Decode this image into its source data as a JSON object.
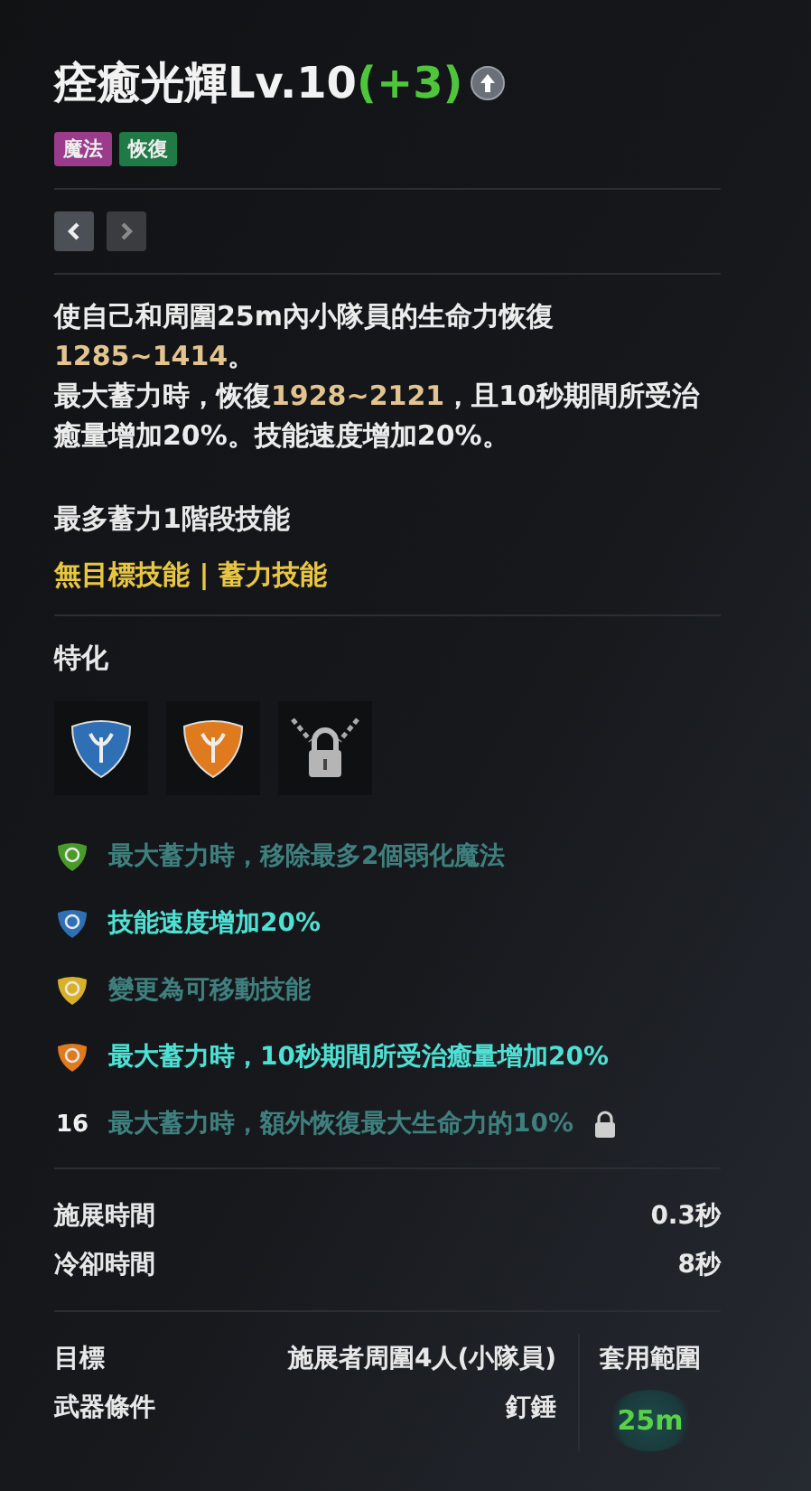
{
  "skill": {
    "name": "痊癒光輝Lv.10",
    "bonus": "(+3)"
  },
  "tags": [
    {
      "label": "魔法",
      "color": "#9b3b8c"
    },
    {
      "label": "恢復",
      "color": "#1f7a45"
    }
  ],
  "nav": [
    {
      "kind": "prev",
      "disabled": false
    },
    {
      "kind": "next",
      "disabled": true
    }
  ],
  "description": [
    {
      "text": "使自己和周圍25m內小隊員的生命力恢復",
      "highlight": false
    },
    {
      "text": "1285~1414",
      "highlight": true
    },
    {
      "text": "。",
      "highlight": false
    },
    {
      "text": "最大蓄力時，恢復",
      "highlight": false
    },
    {
      "text": "1928~2121",
      "highlight": true
    },
    {
      "text": "，且10秒期間所受治癒量增加20%。技能速度增加20%。",
      "highlight": false
    }
  ],
  "charge_note": "最多蓄力1階段技能",
  "skill_types": "無目標技能 | 蓄力技能",
  "specialization": {
    "title": "特化",
    "slots": [
      {
        "kind": "gem",
        "color": "#2f6fb5"
      },
      {
        "kind": "gem",
        "color": "#e07a1f"
      },
      {
        "kind": "locked"
      }
    ],
    "options": [
      {
        "kind": "gem",
        "color": "#4a9a2a",
        "text": "最大蓄力時，移除最多2個弱化魔法",
        "active": false
      },
      {
        "kind": "gem",
        "color": "#2f6fb5",
        "text": "技能速度增加20%",
        "active": true
      },
      {
        "kind": "gem",
        "color": "#d9b02a",
        "text": "變更為可移動技能",
        "active": false
      },
      {
        "kind": "gem",
        "color": "#e07a1f",
        "text": "最大蓄力時，10秒期間所受治癒量增加20%",
        "active": true
      },
      {
        "kind": "locked",
        "level": "16",
        "text": "最大蓄力時，額外恢復最大生命力的10%",
        "active": false
      }
    ]
  },
  "timing": [
    {
      "label": "施展時間",
      "value": "0.3秒"
    },
    {
      "label": "冷卻時間",
      "value": "8秒"
    }
  ],
  "info": [
    {
      "label": "目標",
      "value": "施展者周圍4人(小隊員)"
    },
    {
      "label": "武器條件",
      "value": "釘錘"
    }
  ],
  "range": {
    "label": "套用範圍",
    "value": "25m"
  }
}
